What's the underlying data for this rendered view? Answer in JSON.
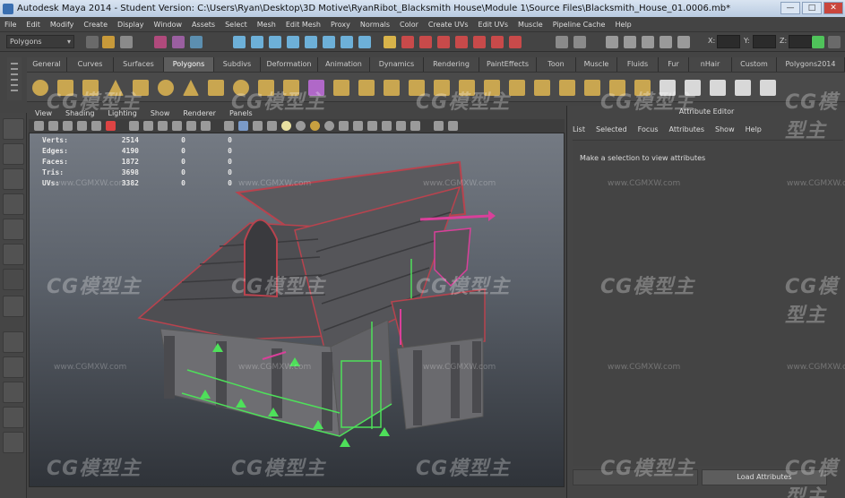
{
  "window": {
    "title": "Autodesk Maya 2014 - Student Version: C:\\Users\\Ryan\\Desktop\\3D Motive\\RyanRibot_Blacksmith House\\Module 1\\Source Files\\Blacksmith_House_01.0006.mb*",
    "min_glyph": "—",
    "max_glyph": "□",
    "close_glyph": "✕"
  },
  "menubar": [
    "File",
    "Edit",
    "Modify",
    "Create",
    "Display",
    "Window",
    "Assets",
    "Select",
    "Mesh",
    "Edit Mesh",
    "Proxy",
    "Normals",
    "Color",
    "Create UVs",
    "Edit UVs",
    "Muscle",
    "Pipeline Cache",
    "Help"
  ],
  "statusline": {
    "mode": "Polygons",
    "coord_labels": [
      "X:",
      "Y:",
      "Z:"
    ]
  },
  "shelf": {
    "tabs": [
      "General",
      "Curves",
      "Surfaces",
      "Polygons",
      "Subdivs",
      "Deformation",
      "Animation",
      "Dynamics",
      "Rendering",
      "PaintEffects",
      "Toon",
      "Muscle",
      "Fluids",
      "Fur",
      "nHair",
      "Custom",
      "Polygons2014"
    ],
    "active_tab": "Polygons"
  },
  "panel": {
    "menu": [
      "View",
      "Shading",
      "Lighting",
      "Show",
      "Renderer",
      "Panels"
    ]
  },
  "hud": {
    "rows": [
      {
        "label": "Verts:",
        "v1": "2514",
        "v2": "0",
        "v3": "0"
      },
      {
        "label": "Edges:",
        "v1": "4190",
        "v2": "0",
        "v3": "0"
      },
      {
        "label": "Faces:",
        "v1": "1872",
        "v2": "0",
        "v3": "0"
      },
      {
        "label": "Tris:",
        "v1": "3698",
        "v2": "0",
        "v3": "0"
      },
      {
        "label": "UVs:",
        "v1": "3382",
        "v2": "0",
        "v3": "0"
      }
    ]
  },
  "attribute_editor": {
    "title": "Attribute Editor",
    "menu": [
      "List",
      "Selected",
      "Focus",
      "Attributes",
      "Show",
      "Help"
    ],
    "message": "Make a selection to view attributes",
    "load_button": "Load Attributes"
  },
  "watermark": {
    "logo": "CG模型主",
    "url": "www.CGMXW.com"
  },
  "colors": {
    "accent": "#d9409a",
    "selection_green": "#4ee05a",
    "roof_red": "#b8434e",
    "wall_gray": "#6e6e72"
  }
}
